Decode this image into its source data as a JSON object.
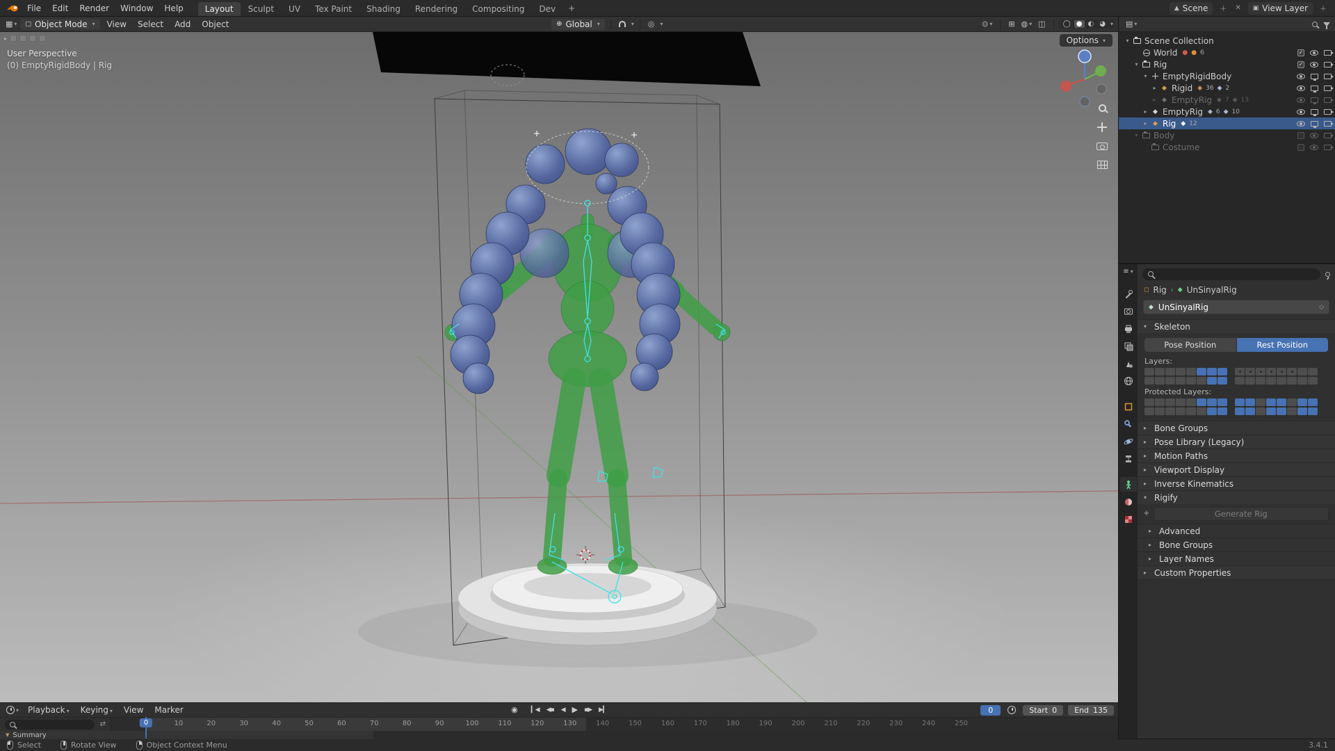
{
  "topbar": {
    "menus": [
      "File",
      "Edit",
      "Render",
      "Window",
      "Help"
    ],
    "workspaces": [
      "Layout",
      "Sculpt",
      "UV",
      "Tex Paint",
      "Shading",
      "Rendering",
      "Compositing",
      "Dev"
    ],
    "active_workspace": "Layout",
    "add_workspace_icon": "+",
    "scene_label": "Scene",
    "view_layer_label": "View Layer"
  },
  "viewport_header": {
    "mode": "Object Mode",
    "menus": [
      "View",
      "Select",
      "Add",
      "Object"
    ],
    "orientation": "Global",
    "options_label": "Options"
  },
  "viewport": {
    "perspective_label": "User Perspective",
    "active_object_label": "(0) EmptyRigidBody | Rig"
  },
  "outliner": {
    "rows": [
      {
        "indent": 0,
        "expand": "open",
        "icon": "collection",
        "label": "Scene Collection",
        "badges": [],
        "controls": []
      },
      {
        "indent": 1,
        "expand": "none",
        "icon": "world",
        "label": "World",
        "badges": [
          {
            "glyph": "●",
            "color": "#cf5d4e"
          },
          {
            "glyph": "●",
            "color": "#d8913f",
            "count": "6"
          }
        ],
        "controls": [
          "check",
          "eye",
          "cam"
        ]
      },
      {
        "indent": 1,
        "expand": "open",
        "icon": "collection",
        "label": "Rig",
        "badges": [],
        "controls": [
          "check",
          "eye",
          "cam"
        ]
      },
      {
        "indent": 2,
        "expand": "open",
        "icon": "empty",
        "label": "EmptyRigidBody",
        "badges": [],
        "controls": [
          "eye",
          "screen",
          "cam"
        ]
      },
      {
        "indent": 3,
        "expand": "closed",
        "icon": "armature-orange",
        "label": "Rigid",
        "badges": [
          {
            "glyph": "◆",
            "color": "#cf8d4e",
            "count": "36"
          },
          {
            "glyph": "◆",
            "color": "#a9b7d0",
            "count": "2"
          }
        ],
        "controls": [
          "eye",
          "screen",
          "cam"
        ]
      },
      {
        "indent": 3,
        "expand": "closed",
        "icon": "armature",
        "label": "EmptyRig",
        "dim": true,
        "badges": [
          {
            "glyph": "◆",
            "color": "#999999",
            "count": "7"
          },
          {
            "glyph": "◆",
            "color": "#999999",
            "count": "13"
          }
        ],
        "controls": [
          "eye",
          "screen",
          "cam"
        ]
      },
      {
        "indent": 2,
        "expand": "closed",
        "icon": "armature",
        "label": "EmptyRig",
        "badges": [
          {
            "glyph": "◆",
            "color": "#a9b7d0",
            "count": "6"
          },
          {
            "glyph": "◆",
            "color": "#a9b7d0",
            "count": "10"
          }
        ],
        "controls": [
          "eye",
          "screen",
          "cam"
        ]
      },
      {
        "indent": 2,
        "expand": "closed",
        "icon": "armature-orange",
        "label": "Rig",
        "selected": true,
        "badges": [
          {
            "glyph": "◆",
            "color": "#ffffff",
            "count": "12"
          }
        ],
        "controls": [
          "eye",
          "screen",
          "cam"
        ]
      },
      {
        "indent": 1,
        "expand": "open",
        "icon": "collection",
        "label": "Body",
        "dim": true,
        "badges": [],
        "controls": [
          "check-empty",
          "eye",
          "cam"
        ]
      },
      {
        "indent": 2,
        "expand": "none",
        "icon": "collection",
        "label": "Costume",
        "dim": true,
        "badges": [],
        "controls": [
          "check-empty",
          "eye",
          "cam"
        ]
      }
    ]
  },
  "properties": {
    "breadcrumb": {
      "root": "Rig",
      "item": "UnSinyalRig"
    },
    "name_value": "UnSinyalRig",
    "skeleton": {
      "title": "Skeleton",
      "pose_position": "Pose Position",
      "rest_position": "Rest Position",
      "active_position": "rest",
      "layers_label": "Layers:",
      "protected_label": "Protected Layers:",
      "layers": [
        0,
        0,
        0,
        0,
        0,
        2,
        2,
        2,
        1,
        1,
        1,
        1,
        1,
        1,
        0,
        0,
        0,
        0,
        0,
        0,
        0,
        0,
        2,
        2,
        0,
        0,
        0,
        0,
        0,
        0,
        0,
        0
      ],
      "protected_layers": [
        0,
        0,
        0,
        0,
        0,
        2,
        2,
        2,
        2,
        2,
        0,
        2,
        2,
        0,
        2,
        2,
        0,
        0,
        0,
        0,
        0,
        0,
        2,
        2,
        2,
        2,
        0,
        2,
        2,
        0,
        2,
        2
      ]
    },
    "panels": {
      "bone_groups": "Bone Groups",
      "pose_library": "Pose Library (Legacy)",
      "motion_paths": "Motion Paths",
      "viewport_display": "Viewport Display",
      "inverse_kinematics": "Inverse Kinematics",
      "rigify": "Rigify",
      "generate_rig": "Generate Rig",
      "advanced": "Advanced",
      "bone_groups_sub": "Bone Groups",
      "layer_names": "Layer Names",
      "custom_properties": "Custom Properties"
    }
  },
  "timeline": {
    "menus": [
      {
        "label": "Playback",
        "caret": true
      },
      {
        "label": "Keying",
        "caret": true
      },
      {
        "label": "View",
        "caret": false
      },
      {
        "label": "Marker",
        "caret": false
      }
    ],
    "current_frame": "0",
    "start_label": "Start",
    "start_value": "0",
    "end_label": "End",
    "end_value": "135",
    "frame_start": 0,
    "frame_end": 135,
    "playhead_frame": "0",
    "ruler_ticks": [
      10,
      20,
      30,
      40,
      50,
      60,
      70,
      80,
      90,
      100,
      110,
      120,
      130,
      140,
      150,
      160,
      170,
      180,
      190,
      200,
      210,
      220,
      230,
      240,
      250
    ],
    "summary_label": "Summary"
  },
  "statusbar": {
    "items": [
      {
        "icon": "mouse-left",
        "label": "Select"
      },
      {
        "icon": "mouse-middle",
        "label": "Rotate View"
      },
      {
        "icon": "mouse-right",
        "label": "Object Context Menu"
      }
    ],
    "version": "3.4.1"
  }
}
